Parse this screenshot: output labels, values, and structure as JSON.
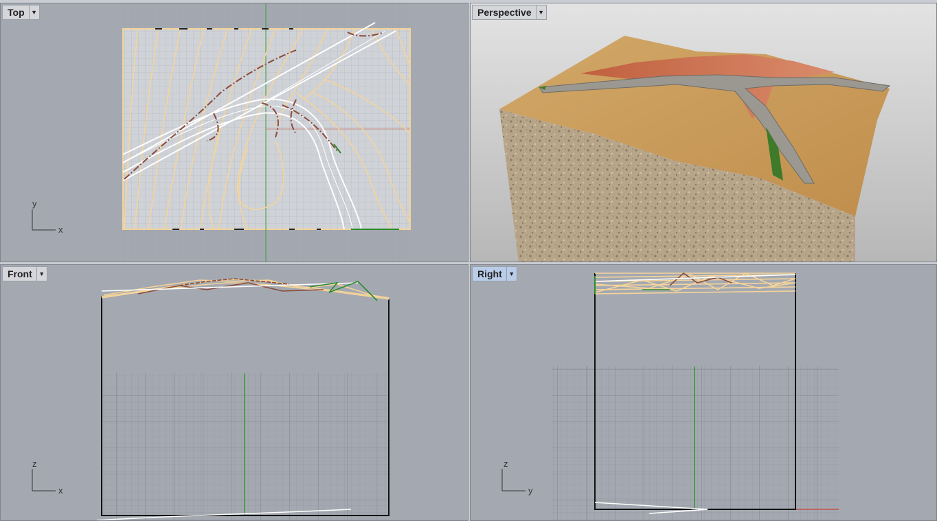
{
  "viewports": {
    "top": {
      "title": "Top",
      "axis_h": "x",
      "axis_v": "y"
    },
    "perspective": {
      "title": "Perspective"
    },
    "front": {
      "title": "Front",
      "axis_h": "x",
      "axis_v": "z"
    },
    "right": {
      "title": "Right",
      "axis_h": "y",
      "axis_v": "z",
      "active": true
    }
  },
  "icons": {
    "viewport_menu": "dropdown-triangle-icon",
    "axis_widget": "axis-gizmo-icon"
  },
  "colors": {
    "viewport_bg": "#a4a9b1",
    "contour": "#f5d49a",
    "road_edge": "#ffffff",
    "dirt_curve": "#8b4a3a",
    "green_curve": "#2a8a2a",
    "active_tab": "#b9cde8"
  }
}
